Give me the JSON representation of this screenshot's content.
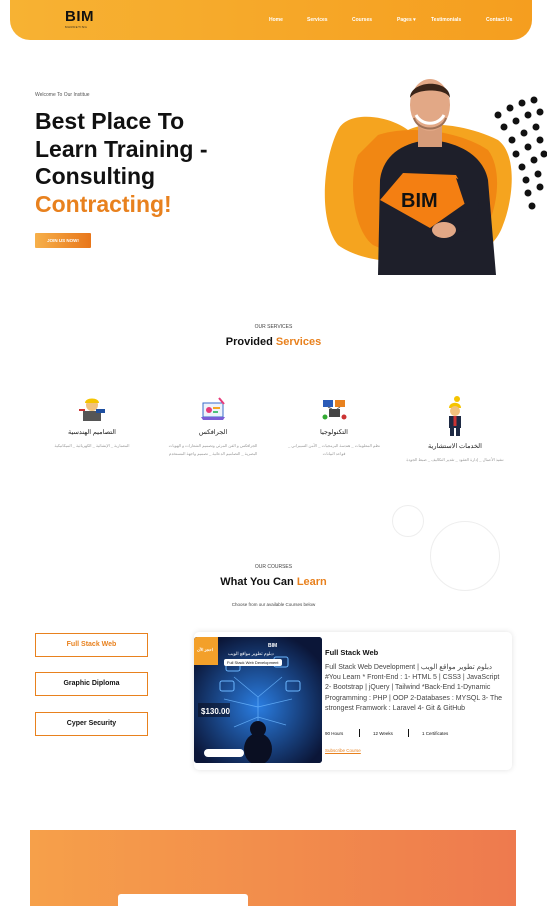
{
  "header": {
    "logo_text": "BIM",
    "logo_sub": "MARKETING",
    "nav": {
      "home": "Home",
      "services": "Services",
      "courses": "Courses",
      "pages": "Pages",
      "testimonials": "Testimonials",
      "contact": "Contact Us"
    }
  },
  "hero": {
    "welcome": "Welcome To Our Institue",
    "title_line1": "Best Place To",
    "title_line2": "Learn Training -",
    "title_line3": "Consulting",
    "title_accent": "Contracting!",
    "join_button": "JOIN US NOW!",
    "shirt_text": "BIM"
  },
  "services": {
    "kicker": "OUR SERVICES",
    "title_plain": "Provided ",
    "title_accent": "Services",
    "items": [
      {
        "title": "التصاميم الهندسية",
        "desc": "المعمارية _ الإنشائية _ الكهربائية _ الميكانيكية",
        "icon": "engineer-icon"
      },
      {
        "title": "الجرافكس",
        "desc": "الجرافكس و الفن المرئي وتصميم الشعارات و الهويات البصرية _ التصاميم الدعائية _ تصميم واجهة المستخدم",
        "icon": "graphics-icon"
      },
      {
        "title": "التكنولوجيا",
        "desc": "نظم المعلومات _ هندسة البرمجيات _ الأمن السيبراني _ قواعد البيانات",
        "icon": "technology-icon"
      },
      {
        "title": "الخدمات الاستشارية",
        "desc": "تنفيذ الأعمال _ إدارة العقود _ تقدير التكاليف _ ضبط الجودة",
        "icon": "consulting-icon"
      }
    ]
  },
  "courses": {
    "kicker": "OUR COURSES",
    "title_plain": "What You Can ",
    "title_accent": "Learn",
    "subtitle": "Choose from our available Courses below",
    "tabs": [
      "Full Stack Web",
      "Graphic Diploma",
      "Cyper Security"
    ],
    "card": {
      "name": "Full Stack Web",
      "description": "Full Stack Web Development | دبلوم تطوير مواقع الويب #You Learn * Front-End : 1- HTML 5 | CSS3 | JavaScript 2- Bootstrap | jQuery | Tailwind *Back-End 1-Dynamic Programming : PHP | OOP 2-Databases : MYSQL 3- The strongest Framwork : Laravel 4- Git & GitHub",
      "hours": "90 Hours",
      "weeks": "12 Weeks",
      "certificates": "1 Certificates",
      "subscribe": "Subscribe Course",
      "price": "$130.00",
      "image_badge": "احجز الآن",
      "image_title": "Full Stack Web Development",
      "image_heading": "دبلوم تطوير مواقع الويب",
      "image_brand": "BIM"
    }
  },
  "colors": {
    "accent": "#e8811e",
    "header": "#f7b233"
  }
}
